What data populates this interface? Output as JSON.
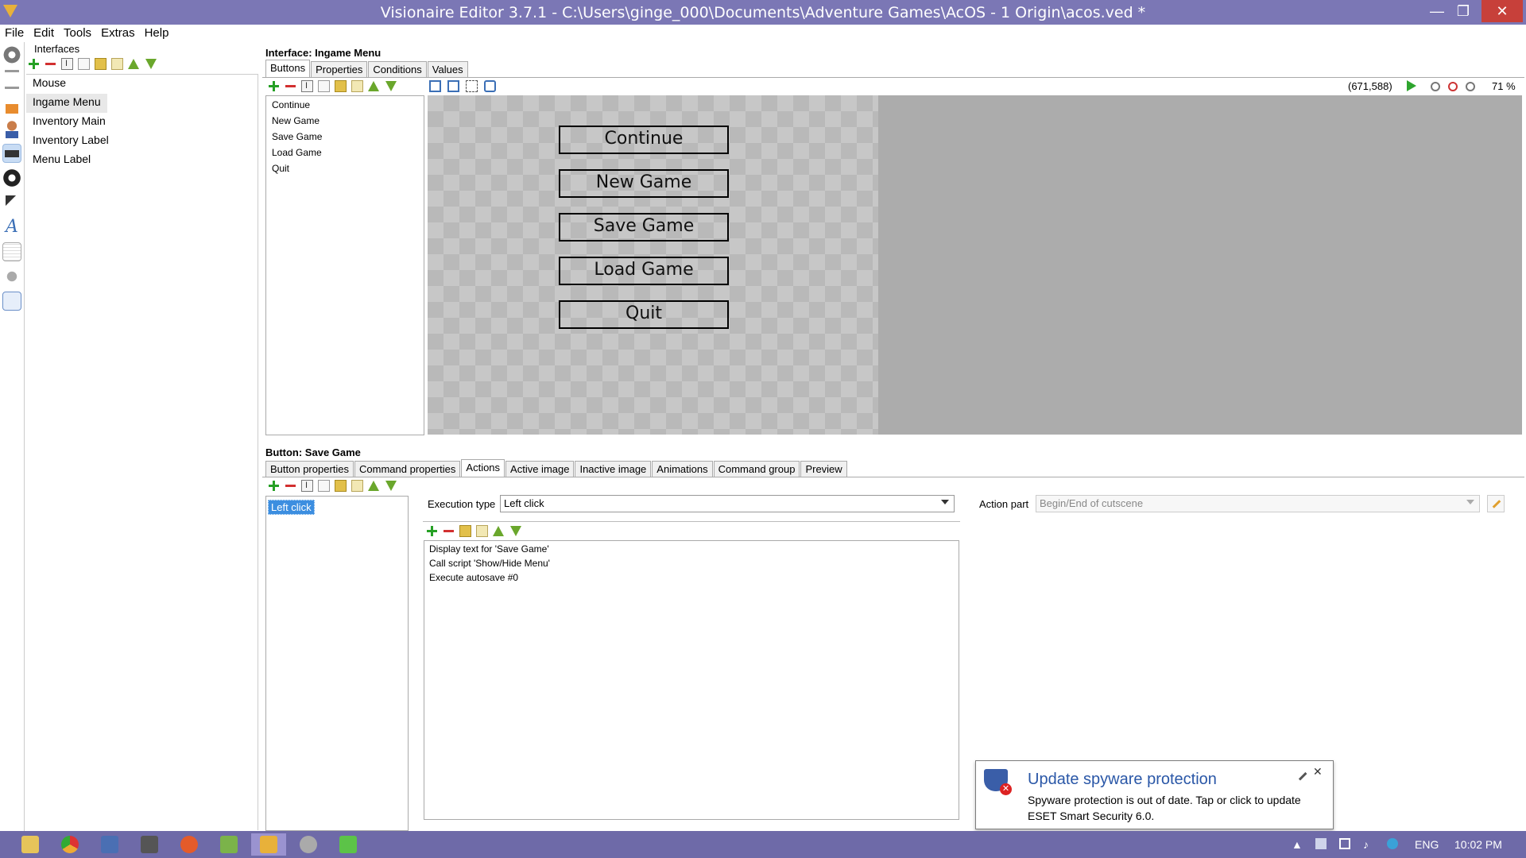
{
  "window": {
    "title": "Visionaire Editor 3.7.1 - C:\\Users\\ginge_000\\Documents\\Adventure Games\\AcOS - 1 Origin\\acos.ved *",
    "minimize": "—",
    "restore": "❐",
    "close": "✕"
  },
  "menu": [
    "File",
    "Edit",
    "Tools",
    "Extras",
    "Help"
  ],
  "left_panel": {
    "title": "Interfaces",
    "items": [
      "Mouse",
      "Ingame Menu",
      "Inventory Main",
      "Inventory Label",
      "Menu Label"
    ],
    "selected_index": 1
  },
  "interface": {
    "header": "Interface: Ingame Menu",
    "tabs": [
      "Buttons",
      "Properties",
      "Conditions",
      "Values"
    ],
    "active_tab": 0,
    "buttons": [
      "Continue",
      "New Game",
      "Save Game",
      "Load Game",
      "Quit"
    ],
    "coords": "(671,588)",
    "zoom": "71 %"
  },
  "canvas_buttons": [
    "Continue",
    "New Game",
    "Save Game",
    "Load Game",
    "Quit"
  ],
  "button_section": {
    "header": "Button: Save Game",
    "tabs": [
      "Button properties",
      "Command properties",
      "Actions",
      "Active image",
      "Inactive image",
      "Animations",
      "Command group",
      "Preview"
    ],
    "active_tab": 2,
    "actions": [
      "Left click"
    ],
    "execution_type_label": "Execution type",
    "execution_type_value": "Left click",
    "action_part_label": "Action part",
    "action_part_value": "Begin/End of cutscene",
    "action_items": [
      "Display text for 'Save Game'",
      "Call script 'Show/Hide Menu'",
      "Execute autosave #0"
    ]
  },
  "notification": {
    "title": "Update spyware protection",
    "body": "Spyware protection is out of date. Tap or click to update ESET Smart Security 6.0."
  },
  "taskbar": {
    "language": "ENG",
    "time": "10:02 PM"
  }
}
